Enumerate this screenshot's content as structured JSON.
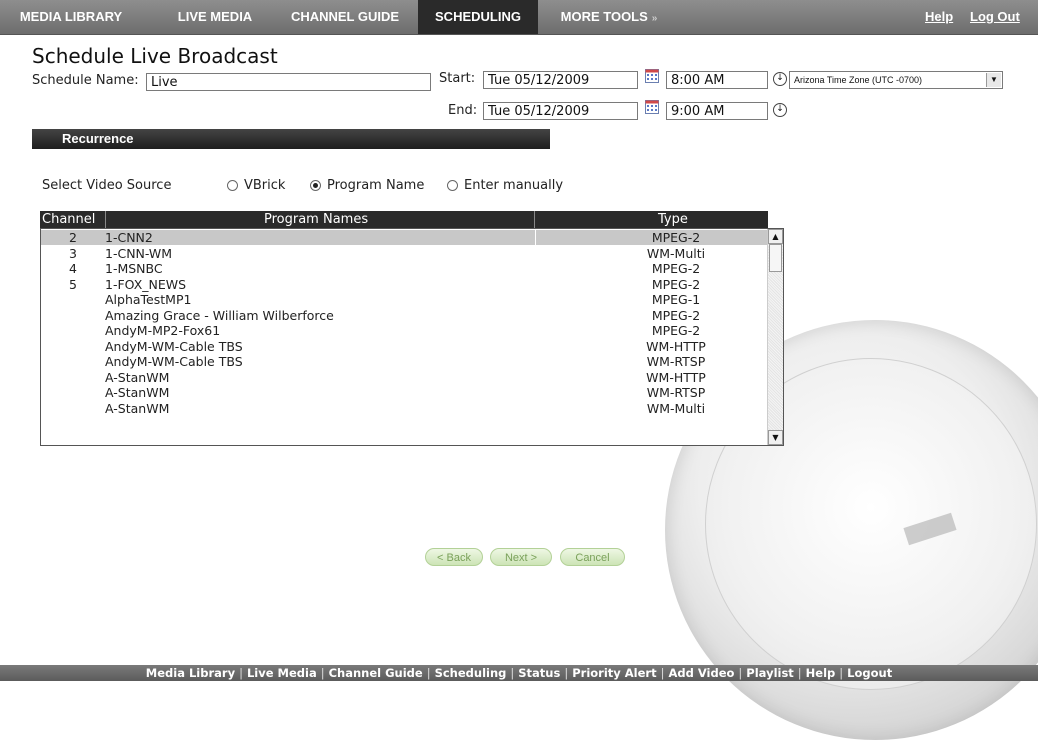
{
  "nav": {
    "tabs": [
      {
        "label": "MEDIA LIBRARY"
      },
      {
        "label": "LIVE MEDIA"
      },
      {
        "label": "CHANNEL GUIDE"
      },
      {
        "label": "SCHEDULING"
      },
      {
        "label": "MORE TOOLS"
      }
    ],
    "help": "Help",
    "logout": "Log Out"
  },
  "page_title": "Schedule Live Broadcast",
  "form": {
    "schedule_name_label": "Schedule Name:",
    "schedule_name_value": "Live",
    "start_label": "Start:",
    "start_date": "Tue 05/12/2009",
    "start_time": "8:00 AM",
    "end_label": "End:",
    "end_date": "Tue 05/12/2009",
    "end_time": "9:00 AM",
    "timezone": "Arizona Time Zone (UTC -0700)"
  },
  "recurrence_label": "Recurrence",
  "video_source": {
    "label": "Select Video Source",
    "options": [
      "VBrick",
      "Program Name",
      "Enter manually"
    ],
    "selected": "Program Name"
  },
  "table": {
    "headers": {
      "channel": "Channel",
      "names": "Program Names",
      "type": "Type"
    },
    "rows": [
      {
        "channel": "2",
        "name": "1-CNN2",
        "type": "MPEG-2"
      },
      {
        "channel": "3",
        "name": "1-CNN-WM",
        "type": "WM-Multi"
      },
      {
        "channel": "4",
        "name": "1-MSNBC",
        "type": "MPEG-2"
      },
      {
        "channel": "5",
        "name": "1-FOX_NEWS",
        "type": "MPEG-2"
      },
      {
        "channel": "",
        "name": "AlphaTestMP1",
        "type": "MPEG-1"
      },
      {
        "channel": "",
        "name": "Amazing Grace - William Wilberforce",
        "type": "MPEG-2"
      },
      {
        "channel": "",
        "name": "AndyM-MP2-Fox61",
        "type": "MPEG-2"
      },
      {
        "channel": "",
        "name": "AndyM-WM-Cable TBS",
        "type": "WM-HTTP"
      },
      {
        "channel": "",
        "name": "AndyM-WM-Cable TBS",
        "type": "WM-RTSP"
      },
      {
        "channel": "",
        "name": "A-StanWM",
        "type": "WM-HTTP"
      },
      {
        "channel": "",
        "name": "A-StanWM",
        "type": "WM-RTSP"
      },
      {
        "channel": "",
        "name": "A-StanWM",
        "type": "WM-Multi"
      }
    ],
    "selected_index": 0
  },
  "buttons": {
    "back": "< Back",
    "next": "Next >",
    "cancel": "Cancel"
  },
  "footer": {
    "links": [
      "Media Library",
      "Live Media",
      "Channel Guide",
      "Scheduling",
      "Status",
      "Priority Alert",
      "Add Video",
      "Playlist",
      "Help",
      "Logout"
    ]
  },
  "colors": {
    "nav_bg": "#7d7d7d",
    "active_tab": "#2a2a2a",
    "button_text": "#7aa15a"
  }
}
